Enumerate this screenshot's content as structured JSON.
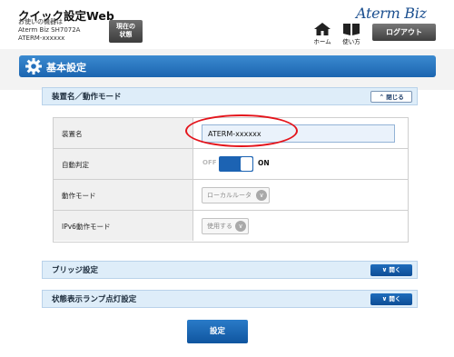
{
  "header": {
    "app_title": "クイック設定Web",
    "device_lines": [
      "お使いの機器は",
      "Aterm Biz SH7072A",
      "ATERM-xxxxxx"
    ],
    "status_button": [
      "現在の",
      "状態"
    ],
    "logo": "Aterm Biz",
    "nav": [
      {
        "label": "ホーム",
        "icon": "home-icon"
      },
      {
        "label": "使い方",
        "icon": "book-icon"
      }
    ],
    "logout_label": "ログアウト"
  },
  "section": {
    "title": "基本設定",
    "icon": "gear-icon",
    "color": "#1f6cb5"
  },
  "panels": {
    "device": {
      "title": "装置名／動作モード",
      "button": "閉じる",
      "expanded": true
    },
    "bridge": {
      "title": "ブリッジ設定",
      "button": "開く",
      "expanded": false
    },
    "lamp": {
      "title": "状態表示ランプ点灯設定",
      "button": "開く",
      "expanded": false
    }
  },
  "settings": {
    "device_name": {
      "label": "装置名",
      "value": "ATERM-xxxxxx"
    },
    "auto_detect": {
      "label": "自動判定",
      "off_label": "OFF",
      "on_label": "ON",
      "state": "ON"
    },
    "operation_mode": {
      "label": "動作モード",
      "value": "ローカルルータ"
    },
    "ipv6_mode": {
      "label": "IPv6動作モード",
      "value": "使用する"
    }
  },
  "submit_label": "設定",
  "accent_color": "#e4141b"
}
